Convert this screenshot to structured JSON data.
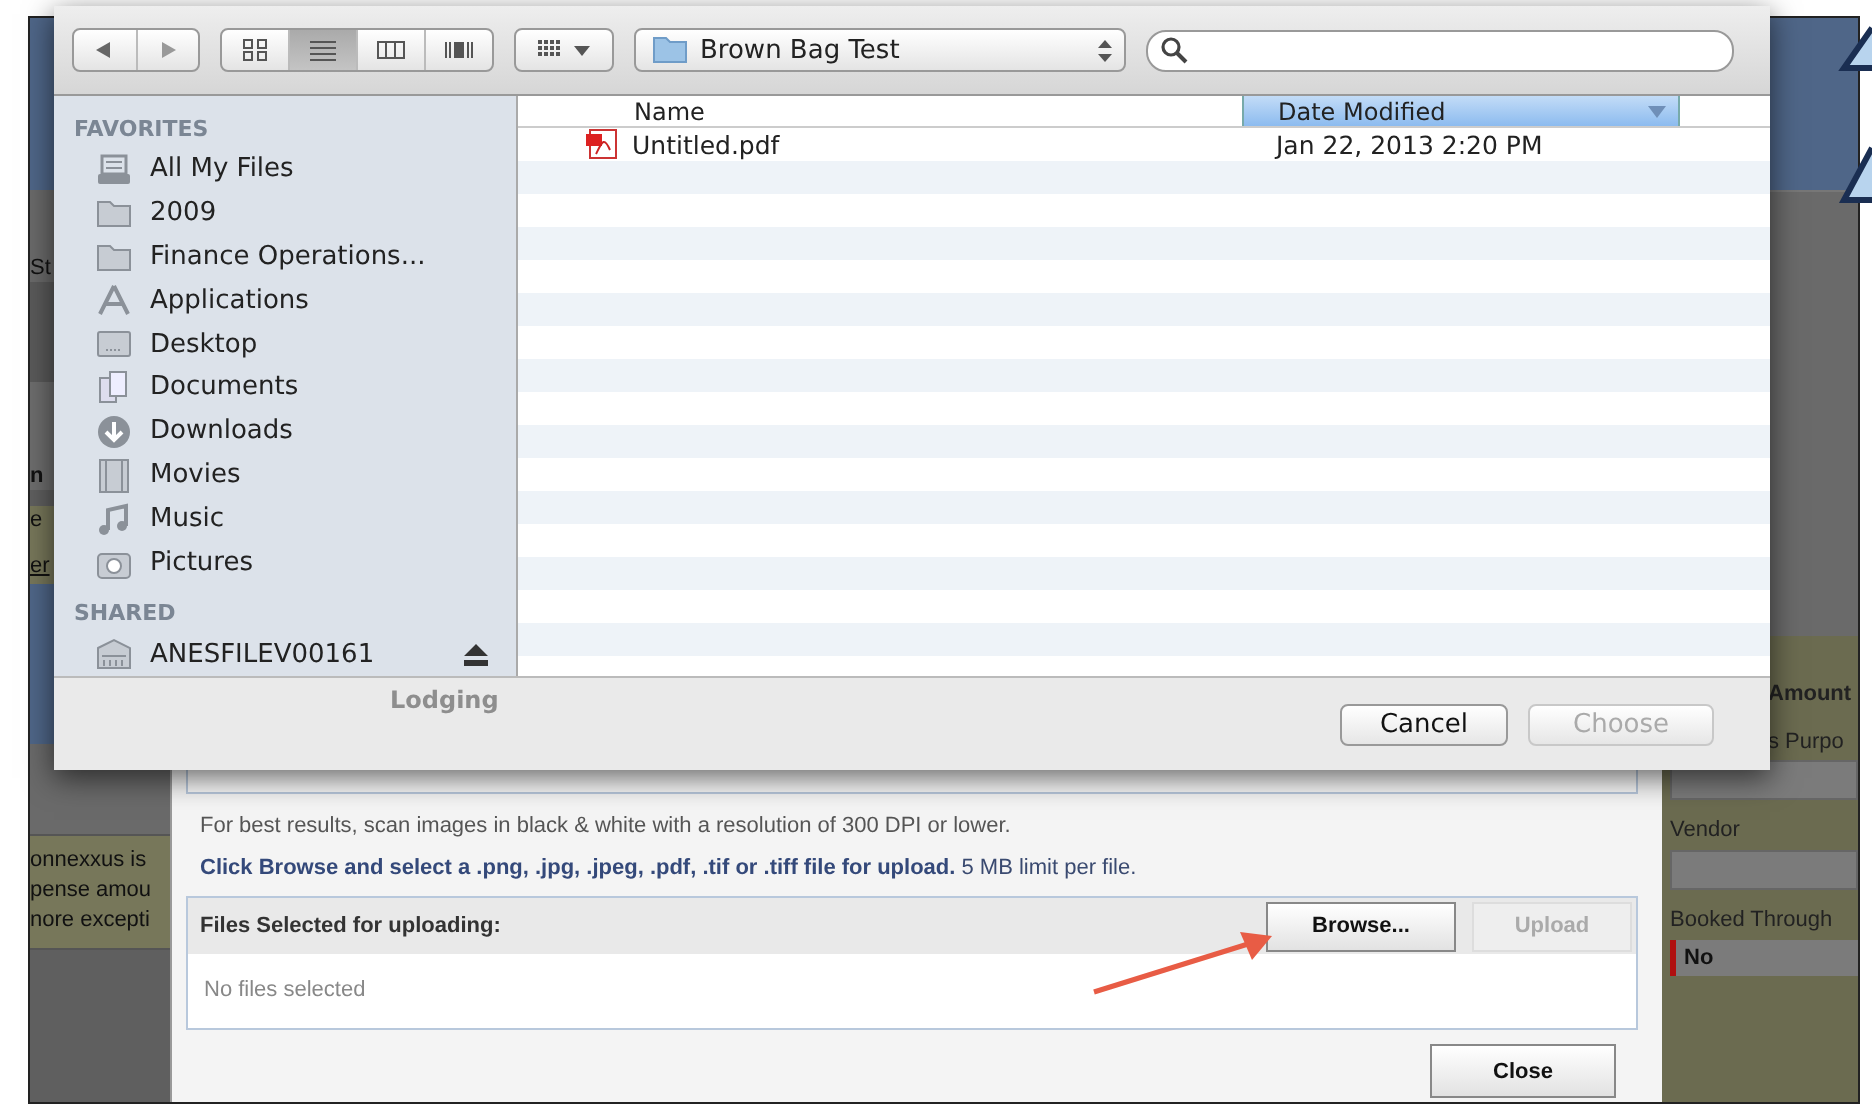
{
  "background_app": {
    "left_fragments": [
      "St",
      "n",
      "e",
      "er"
    ],
    "notice_lines": [
      "onnexxus is",
      "pense amou",
      "nore excepti"
    ],
    "faint_row_label": "Lodging",
    "right_labels": [
      "Amount",
      "s Purpo"
    ],
    "vendor_label": "Vendor",
    "booked_through": {
      "label": "Booked Through",
      "value": "No"
    }
  },
  "upload_dialog": {
    "hint": "For best results, scan images in black & white with a resolution of 300 DPI or lower.",
    "instruction": "**Click Browse and select a .png, .jpg, .jpeg, .pdf, .tif or .tiff file for upload.** 5 MB limit per file.",
    "files_panel": {
      "title": "Files Selected for uploading:",
      "empty_text": "No files selected",
      "buttons": [
        {
          "label": "Browse...",
          "disabled": false
        },
        {
          "label": "Upload",
          "disabled": true
        }
      ]
    },
    "close_button": "Close"
  },
  "file_dialog": {
    "view_modes": [
      {
        "kind": "icons",
        "selected": false
      },
      {
        "kind": "list",
        "selected": true
      },
      {
        "kind": "columns",
        "selected": false
      },
      {
        "kind": "coverflow",
        "selected": false
      }
    ],
    "location": "Brown Bag Test",
    "sidebar": [
      {
        "title": "FAVORITES",
        "items": [
          {
            "label": "All My Files",
            "kind": "all-files",
            "ejectable": false
          },
          {
            "label": "2009",
            "kind": "folder",
            "ejectable": false
          },
          {
            "label": "Finance Operations...",
            "kind": "folder",
            "ejectable": false
          },
          {
            "label": "Applications",
            "kind": "applications",
            "ejectable": false
          },
          {
            "label": "Desktop",
            "kind": "desktop",
            "ejectable": false
          },
          {
            "label": "Documents",
            "kind": "documents",
            "ejectable": false
          },
          {
            "label": "Downloads",
            "kind": "downloads",
            "ejectable": false
          },
          {
            "label": "Movies",
            "kind": "movies",
            "ejectable": false
          },
          {
            "label": "Music",
            "kind": "music",
            "ejectable": false
          },
          {
            "label": "Pictures",
            "kind": "pictures",
            "ejectable": false
          }
        ]
      },
      {
        "title": "SHARED",
        "items": [
          {
            "label": "ANESFILEV00161",
            "kind": "server",
            "ejectable": true
          }
        ]
      }
    ],
    "columns": [
      {
        "label": "Name",
        "selected": false
      },
      {
        "label": "Date Modified",
        "selected": true
      }
    ],
    "files": [
      {
        "name": "Untitled.pdf",
        "date_modified": "Jan 22, 2013 2:20 PM"
      }
    ],
    "buttons": [
      {
        "label": "Cancel",
        "disabled": false
      },
      {
        "label": "Choose",
        "disabled": true
      }
    ]
  }
}
